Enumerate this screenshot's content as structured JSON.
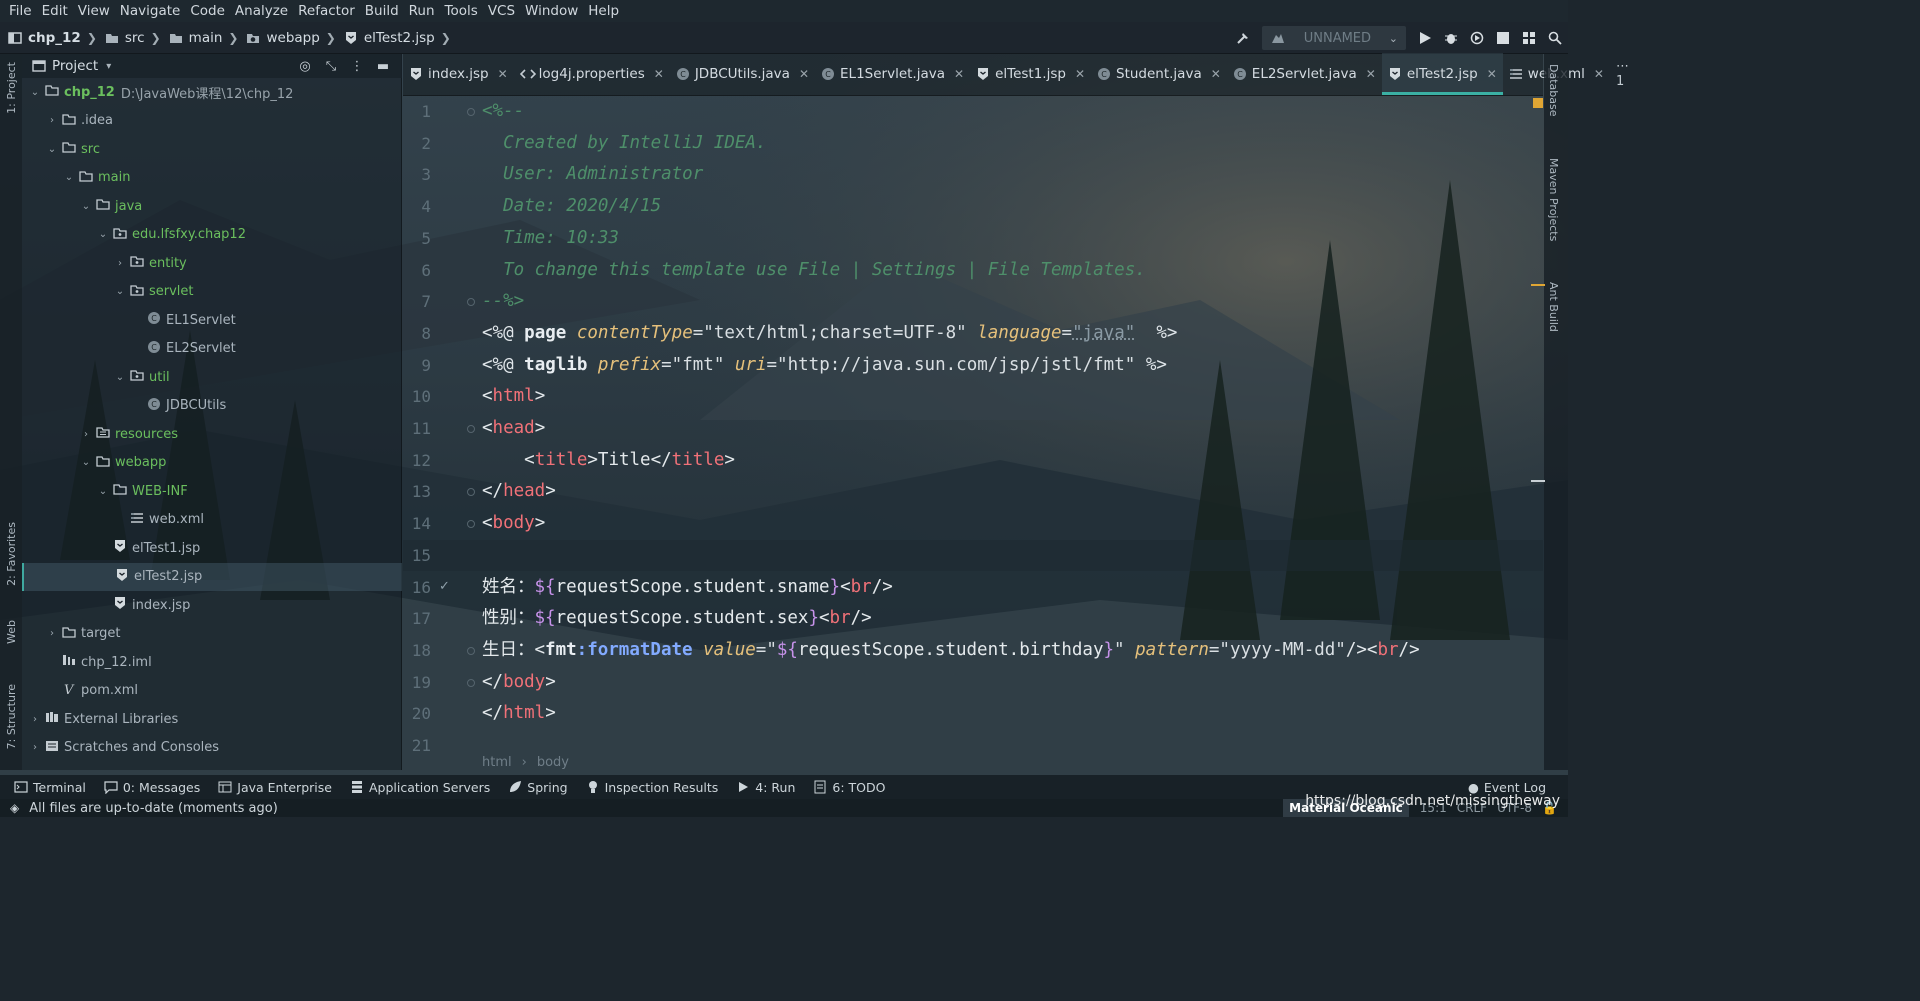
{
  "menu": [
    "File",
    "Edit",
    "View",
    "Navigate",
    "Code",
    "Analyze",
    "Refactor",
    "Build",
    "Run",
    "Tools",
    "VCS",
    "Window",
    "Help"
  ],
  "breadcrumbs": [
    "chp_12",
    "src",
    "main",
    "webapp",
    "elTest2.jsp"
  ],
  "run_config": "UNNAMED",
  "left_strip": {
    "project": "1: Project",
    "favorites": "2: Favorites",
    "web": "Web",
    "structure": "7: Structure"
  },
  "project_panel": {
    "title": "Project",
    "tree": [
      {
        "label": "chp_12",
        "path": "D:\\JavaWeb课程\\12\\chp_12",
        "depth": 0,
        "arrow": "down",
        "icon": "folder-icon"
      },
      {
        "label": ".idea",
        "depth": 1,
        "arrow": "right",
        "icon": "folder-icon"
      },
      {
        "label": "src",
        "depth": 1,
        "arrow": "down",
        "icon": "folder-icon"
      },
      {
        "label": "main",
        "depth": 2,
        "arrow": "down",
        "icon": "folder-icon"
      },
      {
        "label": "java",
        "depth": 3,
        "arrow": "down",
        "icon": "folder-icon"
      },
      {
        "label": "edu.lfsfxy.chap12",
        "depth": 4,
        "arrow": "down",
        "icon": "package-icon"
      },
      {
        "label": "entity",
        "depth": 5,
        "arrow": "right",
        "icon": "package-icon"
      },
      {
        "label": "servlet",
        "depth": 5,
        "arrow": "down",
        "icon": "package-icon"
      },
      {
        "label": "EL1Servlet",
        "depth": 6,
        "arrow": "",
        "icon": "class-icon"
      },
      {
        "label": "EL2Servlet",
        "depth": 6,
        "arrow": "",
        "icon": "class-icon"
      },
      {
        "label": "util",
        "depth": 5,
        "arrow": "down",
        "icon": "package-icon"
      },
      {
        "label": "JDBCUtils",
        "depth": 6,
        "arrow": "",
        "icon": "class-icon"
      },
      {
        "label": "resources",
        "depth": 3,
        "arrow": "right",
        "icon": "resources-folder-icon"
      },
      {
        "label": "webapp",
        "depth": 3,
        "arrow": "down",
        "icon": "folder-icon"
      },
      {
        "label": "WEB-INF",
        "depth": 4,
        "arrow": "down",
        "icon": "folder-icon"
      },
      {
        "label": "web.xml",
        "depth": 5,
        "arrow": "",
        "icon": "xml-icon"
      },
      {
        "label": "elTest1.jsp",
        "depth": 4,
        "arrow": "",
        "icon": "jsp-icon"
      },
      {
        "label": "elTest2.jsp",
        "depth": 4,
        "arrow": "",
        "icon": "jsp-icon",
        "selected": true
      },
      {
        "label": "index.jsp",
        "depth": 4,
        "arrow": "",
        "icon": "jsp-icon"
      },
      {
        "label": "target",
        "depth": 1,
        "arrow": "right",
        "icon": "folder-icon"
      },
      {
        "label": "chp_12.iml",
        "depth": 1,
        "arrow": "",
        "icon": "iml-icon"
      },
      {
        "label": "pom.xml",
        "depth": 1,
        "arrow": "",
        "icon": "maven-icon"
      },
      {
        "label": "External Libraries",
        "depth": 0,
        "arrow": "right",
        "icon": "library-icon"
      },
      {
        "label": "Scratches and Consoles",
        "depth": 0,
        "arrow": "right",
        "icon": "scratches-icon"
      }
    ]
  },
  "tabs": [
    {
      "label": "index.jsp",
      "icon": "jsp-icon"
    },
    {
      "label": "log4j.properties",
      "icon": "properties-icon"
    },
    {
      "label": "JDBCUtils.java",
      "icon": "class-icon"
    },
    {
      "label": "EL1Servlet.java",
      "icon": "class-icon"
    },
    {
      "label": "elTest1.jsp",
      "icon": "jsp-icon"
    },
    {
      "label": "Student.java",
      "icon": "class-icon"
    },
    {
      "label": "EL2Servlet.java",
      "icon": "class-icon"
    },
    {
      "label": "elTest2.jsp",
      "icon": "jsp-icon",
      "active": true
    },
    {
      "label": "web.xml",
      "icon": "xml-icon"
    }
  ],
  "tab_more": "⋯ 1",
  "code_lines": [
    [
      {
        "t": "<%--",
        "c": "comment"
      }
    ],
    [
      {
        "t": "  Created by IntelliJ IDEA.",
        "c": "comment"
      }
    ],
    [
      {
        "t": "  User: Administrator",
        "c": "comment"
      }
    ],
    [
      {
        "t": "  Date: 2020/4/15",
        "c": "comment"
      }
    ],
    [
      {
        "t": "  Time: 10:33",
        "c": "comment"
      }
    ],
    [
      {
        "t": "  To change this template use File | Settings | File Templates.",
        "c": "comment"
      }
    ],
    [
      {
        "t": "--%>",
        "c": "comment"
      }
    ],
    [
      {
        "t": "<%@ ",
        "c": "dir"
      },
      {
        "t": "page ",
        "c": "kw"
      },
      {
        "t": "contentType",
        "c": "attr"
      },
      {
        "t": "=\"text/html;charset=UTF-8\" ",
        "c": "str"
      },
      {
        "t": "language",
        "c": "attr"
      },
      {
        "t": "=",
        "c": "str"
      },
      {
        "t": "\"java\"",
        "c": "str-dim"
      },
      {
        "t": "  %>",
        "c": "dir"
      }
    ],
    [
      {
        "t": "<%@ ",
        "c": "dir"
      },
      {
        "t": "taglib ",
        "c": "kw"
      },
      {
        "t": "prefix",
        "c": "attr"
      },
      {
        "t": "=\"fmt\" ",
        "c": "str"
      },
      {
        "t": "uri",
        "c": "attr"
      },
      {
        "t": "=\"http://java.sun.com/jsp/jstl/fmt\" ",
        "c": "str"
      },
      {
        "t": "%>",
        "c": "dir"
      }
    ],
    [
      {
        "t": "<",
        "c": "text"
      },
      {
        "t": "html",
        "c": "tag"
      },
      {
        "t": ">",
        "c": "text"
      }
    ],
    [
      {
        "t": "<",
        "c": "text"
      },
      {
        "t": "head",
        "c": "tag"
      },
      {
        "t": ">",
        "c": "text"
      }
    ],
    [
      {
        "t": "    <",
        "c": "text"
      },
      {
        "t": "title",
        "c": "tag"
      },
      {
        "t": ">Title</",
        "c": "text"
      },
      {
        "t": "title",
        "c": "tag"
      },
      {
        "t": ">",
        "c": "text"
      }
    ],
    [
      {
        "t": "</",
        "c": "text"
      },
      {
        "t": "head",
        "c": "tag"
      },
      {
        "t": ">",
        "c": "text"
      }
    ],
    [
      {
        "t": "<",
        "c": "text"
      },
      {
        "t": "body",
        "c": "tag"
      },
      {
        "t": ">",
        "c": "text"
      }
    ],
    [
      {
        "t": "",
        "c": "text"
      }
    ],
    [
      {
        "t": "姓名：",
        "c": "text"
      },
      {
        "t": "${",
        "c": "el"
      },
      {
        "t": "requestScope.student.sname",
        "c": "text"
      },
      {
        "t": "}",
        "c": "el"
      },
      {
        "t": "<",
        "c": "text"
      },
      {
        "t": "br",
        "c": "tag"
      },
      {
        "t": "/>",
        "c": "text"
      }
    ],
    [
      {
        "t": "性别：",
        "c": "text"
      },
      {
        "t": "${",
        "c": "el"
      },
      {
        "t": "requestScope.student.sex",
        "c": "text"
      },
      {
        "t": "}",
        "c": "el"
      },
      {
        "t": "<",
        "c": "text"
      },
      {
        "t": "br",
        "c": "tag"
      },
      {
        "t": "/>",
        "c": "text"
      }
    ],
    [
      {
        "t": "生日：",
        "c": "text"
      },
      {
        "t": "<",
        "c": "text"
      },
      {
        "t": "fmt",
        "c": "ns"
      },
      {
        "t": ":formatDate ",
        "c": "fn"
      },
      {
        "t": "value",
        "c": "attr"
      },
      {
        "t": "=\"",
        "c": "str"
      },
      {
        "t": "${",
        "c": "el"
      },
      {
        "t": "requestScope.student.birthday",
        "c": "text"
      },
      {
        "t": "}",
        "c": "el"
      },
      {
        "t": "\" ",
        "c": "str"
      },
      {
        "t": "pattern",
        "c": "attr"
      },
      {
        "t": "=\"yyyy-MM-dd\"",
        "c": "str"
      },
      {
        "t": "/><",
        "c": "text"
      },
      {
        "t": "br",
        "c": "tag"
      },
      {
        "t": "/>",
        "c": "text"
      }
    ],
    [
      {
        "t": "</",
        "c": "text"
      },
      {
        "t": "body",
        "c": "tag"
      },
      {
        "t": ">",
        "c": "text"
      }
    ],
    [
      {
        "t": "</",
        "c": "text"
      },
      {
        "t": "html",
        "c": "tag"
      },
      {
        "t": ">",
        "c": "text"
      }
    ],
    [
      {
        "t": "",
        "c": "text"
      }
    ]
  ],
  "editor_crumbs": [
    "html",
    "body"
  ],
  "right_strip": [
    "Database",
    "Maven Projects",
    "Ant Build"
  ],
  "bottom_tools": [
    {
      "label": "Terminal",
      "icon": "terminal-icon"
    },
    {
      "label": "0: Messages",
      "icon": "messages-icon"
    },
    {
      "label": "Java Enterprise",
      "icon": "java-enterprise-icon"
    },
    {
      "label": "Application Servers",
      "icon": "servers-icon"
    },
    {
      "label": "Spring",
      "icon": "spring-icon"
    },
    {
      "label": "Inspection Results",
      "icon": "inspection-icon"
    },
    {
      "label": "4: Run",
      "icon": "run-icon"
    },
    {
      "label": "6: TODO",
      "icon": "todo-icon"
    }
  ],
  "event_log": "Event Log",
  "status": {
    "message": "All files are up-to-date (moments ago)",
    "theme": "Material Oceanic",
    "position": "15:1",
    "line_sep": "CRLF",
    "encoding": "UTF-8"
  },
  "watermark": "https://blog.csdn.net/missingtheway",
  "colors": {
    "accent": "#3bb0a4",
    "comment": "#4e8f6a",
    "attribute": "#e5c07b",
    "tag": "#f07178",
    "el": "#c792ea",
    "package": "#6bbf5e"
  }
}
